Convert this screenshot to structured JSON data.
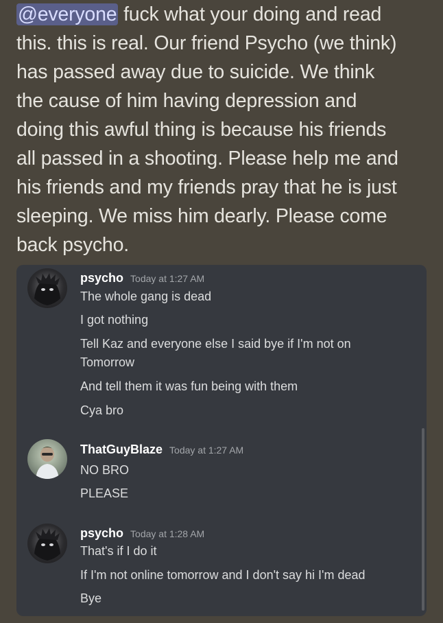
{
  "post": {
    "mention": "@everyone",
    "line1_rest": " fuck what your doing and read",
    "lines": [
      "this. this is real. Our friend Psycho (we think)",
      "has passed away due to suicide. We think",
      "the cause of him having depression and",
      "doing this awful thing is because his friends",
      "all passed in a shooting. Please help me and",
      "his friends and my friends pray that he is just",
      "sleeping. We miss him dearly. Please come",
      "back psycho."
    ]
  },
  "chat": {
    "groups": [
      {
        "author": "psycho",
        "time": "Today at 1:27 AM",
        "avatar_icon": "user-avatar-icon",
        "messages": [
          "The whole gang is dead",
          "I got nothing",
          "Tell Kaz and everyone else I said bye if I'm not on",
          "Tomorrow",
          "And tell them it was fun being with them",
          "Cya bro"
        ]
      },
      {
        "author": "ThatGuyBlaze",
        "time": "Today at 1:27 AM",
        "avatar_icon": "user-avatar-icon",
        "messages": [
          "NO BRO",
          "PLEASE"
        ]
      },
      {
        "author": "psycho",
        "time": "Today at 1:28 AM",
        "avatar_icon": "user-avatar-icon",
        "messages": [
          "That's if I do it",
          "If I'm not online tomorrow and I don't say hi I'm dead",
          "Bye"
        ]
      }
    ]
  },
  "colors": {
    "page_background": "#4a453c",
    "embed_background": "#36393f",
    "mention_background": "#5a5f8a"
  }
}
